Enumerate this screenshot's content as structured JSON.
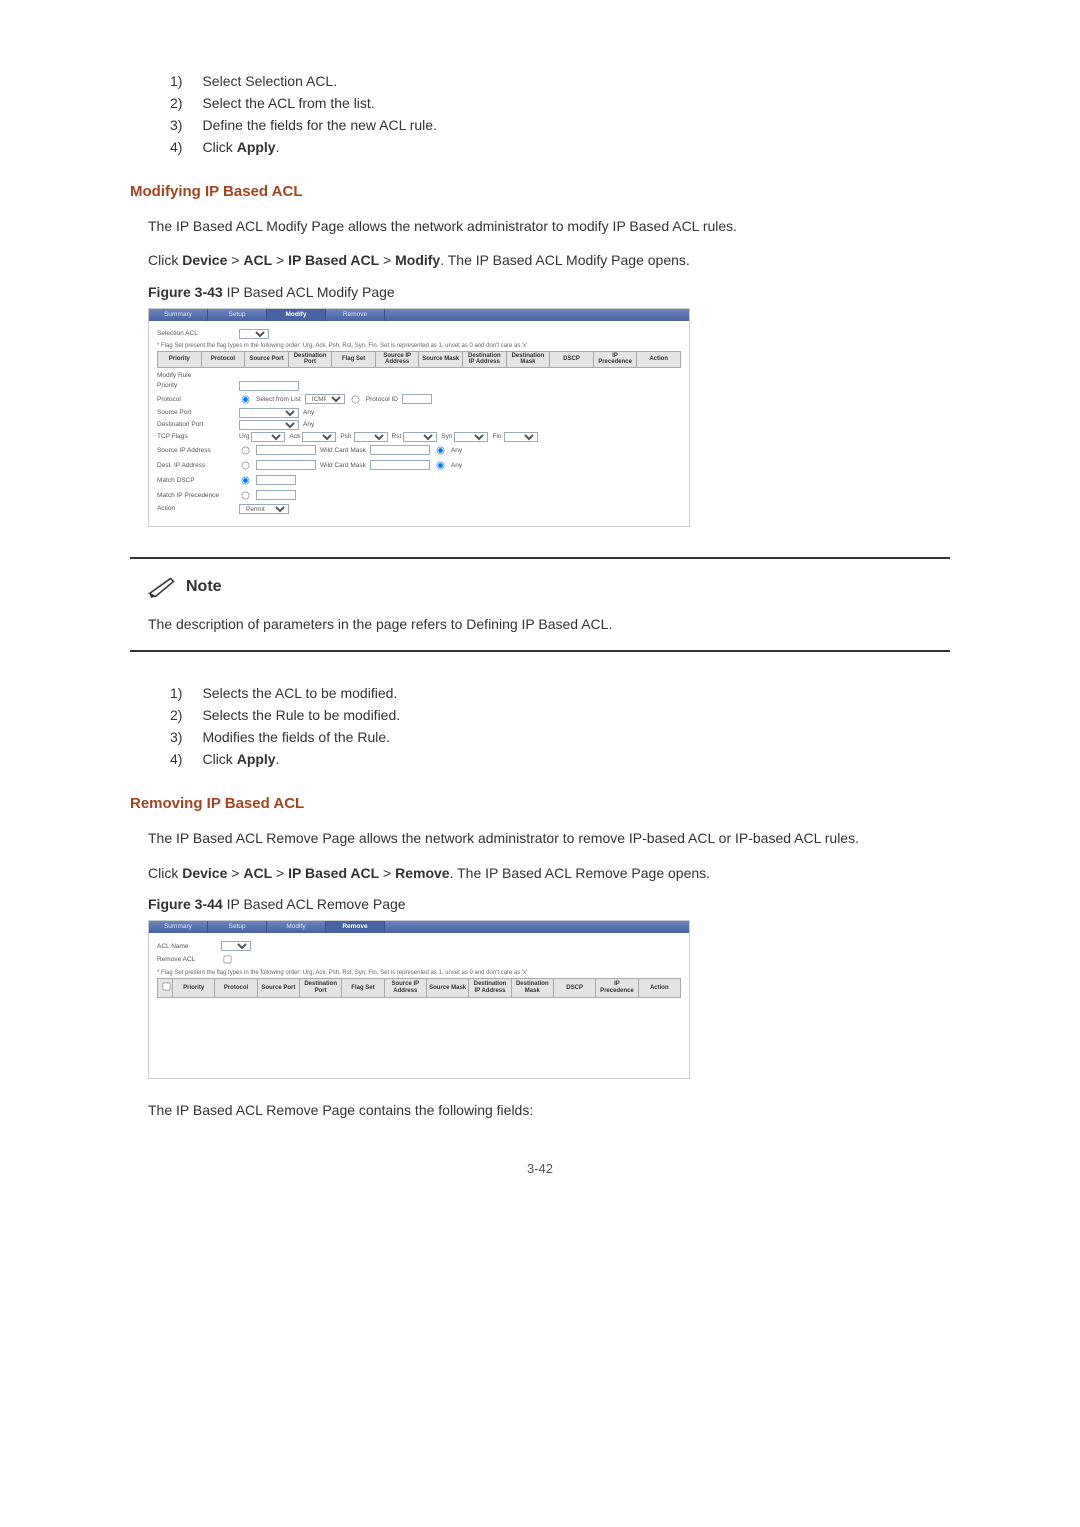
{
  "steps_a": [
    "Select Selection ACL.",
    "Select the ACL from the list.",
    "Define the fields for the new ACL rule.",
    "Click "
  ],
  "apply_label": "Apply",
  "heading_modify": "Modifying IP Based ACL",
  "modify_intro": "The IP Based ACL Modify Page allows the network administrator to modify IP Based ACL rules.",
  "breadcrumb_prefix": "Click ",
  "breadcrumb_parts": {
    "device": "Device",
    "acl": "ACL",
    "ipacl": "IP Based ACL",
    "modify": "Modify",
    "remove": "Remove"
  },
  "breadcrumb_modify_suffix": ". The IP Based ACL Modify Page opens.",
  "breadcrumb_remove_suffix": ". The IP Based ACL Remove Page opens.",
  "fig43": {
    "label": "Figure 3-43",
    "caption": " IP Based ACL Modify Page"
  },
  "fig44": {
    "label": "Figure 3-44",
    "caption": " IP Based ACL Remove Page"
  },
  "note_label": "Note",
  "note_text": "The description of parameters in the page refers to Defining IP Based ACL.",
  "steps_b": [
    "Selects the ACL to be modified.",
    "Selects the Rule to be modified.",
    "Modifies the fields of the Rule.",
    "Click "
  ],
  "heading_remove": "Removing IP Based ACL",
  "remove_intro": "The IP Based ACL Remove Page allows the network administrator to remove IP-based ACL or IP-based ACL rules.",
  "remove_tail": "The IP Based ACL Remove Page contains the following fields:",
  "page_number": "3-42",
  "shot": {
    "tabs": [
      "Summary",
      "Setup",
      "Modify",
      "Remove"
    ],
    "selection_acl": "Selection ACL",
    "flag_hint": "* Flag Set present the flag types in the following order: Urg, Ack, Psh, Rst, Syn, Fin. Set is represented as 1, unset as 0 and don't care as 'x'",
    "headers": [
      "Priority",
      "Protocol",
      "Source Port",
      "Destination Port",
      "Flag Set",
      "Source IP Address",
      "Source Mask",
      "Destination IP Address",
      "Destination Mask",
      "DSCP",
      "IP Precedence",
      "Action"
    ],
    "modify_rule": "Modify Rule",
    "rows": {
      "priority": "Priority",
      "protocol": "Protocol",
      "select_from_list": "Select from List",
      "icmp": "ICMP",
      "protocol_id": "Protocol ID",
      "source_port": "Source Port",
      "any": "Any",
      "dest_port": "Destination Port",
      "tcp_flags": "TCP Flags",
      "flags": [
        "Urg",
        "Ack",
        "Psh",
        "Rst",
        "Syn",
        "Fin"
      ],
      "src_ip": "Source IP Address",
      "wild": "Wild Card Mask",
      "dst_ip": "Dest. IP Address",
      "match_dscp": "Match DSCP",
      "match_ipp": "Match IP Precedence",
      "action": "Action",
      "action_val": "Permit"
    },
    "acl_name": "ACL Name",
    "remove_acl": "Remove ACL"
  }
}
